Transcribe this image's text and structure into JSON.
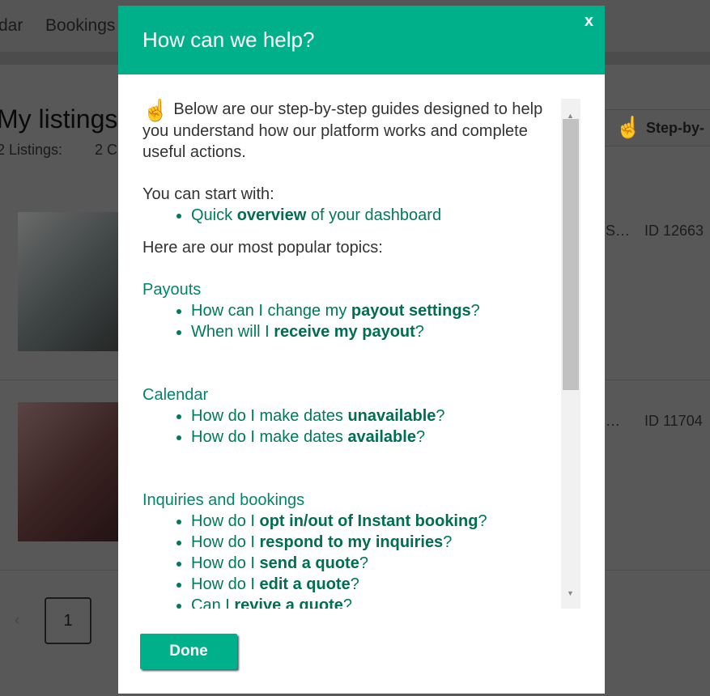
{
  "background": {
    "nav": [
      "dar",
      "Bookings"
    ],
    "title": "My listings",
    "listings_count": "2 Listings:",
    "sub2": "2 C",
    "step_button": "Step-by-",
    "rows": [
      {
        "name": "S…",
        "id": "ID 12663"
      },
      {
        "name": "…",
        "id": "ID 11704"
      }
    ],
    "pager": {
      "prev": "‹",
      "page": "1"
    }
  },
  "modal": {
    "title": "How can we help?",
    "close": "x",
    "intro": "Below are our step-by-step guides designed to help you understand how our platform works and complete useful actions.",
    "start_label": "You can start with:",
    "start_item": {
      "pre": "Quick ",
      "bold": "overview",
      "post": " of your dashboard"
    },
    "popular_label": "Here are our most popular topics:",
    "sections": [
      {
        "title": "Payouts",
        "items": [
          {
            "pre": "How can I change my ",
            "bold": "payout settings",
            "post": "?"
          },
          {
            "pre": "When will I ",
            "bold": "receive my payout",
            "post": "?"
          }
        ]
      },
      {
        "title": "Calendar",
        "items": [
          {
            "pre": "How do I make dates ",
            "bold": "unavailable",
            "post": "?"
          },
          {
            "pre": "How do I make dates ",
            "bold": "available",
            "post": "?"
          }
        ]
      },
      {
        "title": "Inquiries and bookings",
        "items": [
          {
            "pre": "How do I ",
            "bold": "opt in/out of Instant booking",
            "post": "?"
          },
          {
            "pre": "How do I ",
            "bold": "respond to my inquiries",
            "post": "?"
          },
          {
            "pre": "How do I ",
            "bold": "send a quote",
            "post": "?"
          },
          {
            "pre": "How do I ",
            "bold": "edit a quote",
            "post": "?"
          },
          {
            "pre": "Can I ",
            "bold": "revive a quote",
            "post": "?"
          }
        ]
      }
    ],
    "done": "Done",
    "colors": {
      "accent": "#00b08a",
      "link": "#00795c"
    }
  }
}
